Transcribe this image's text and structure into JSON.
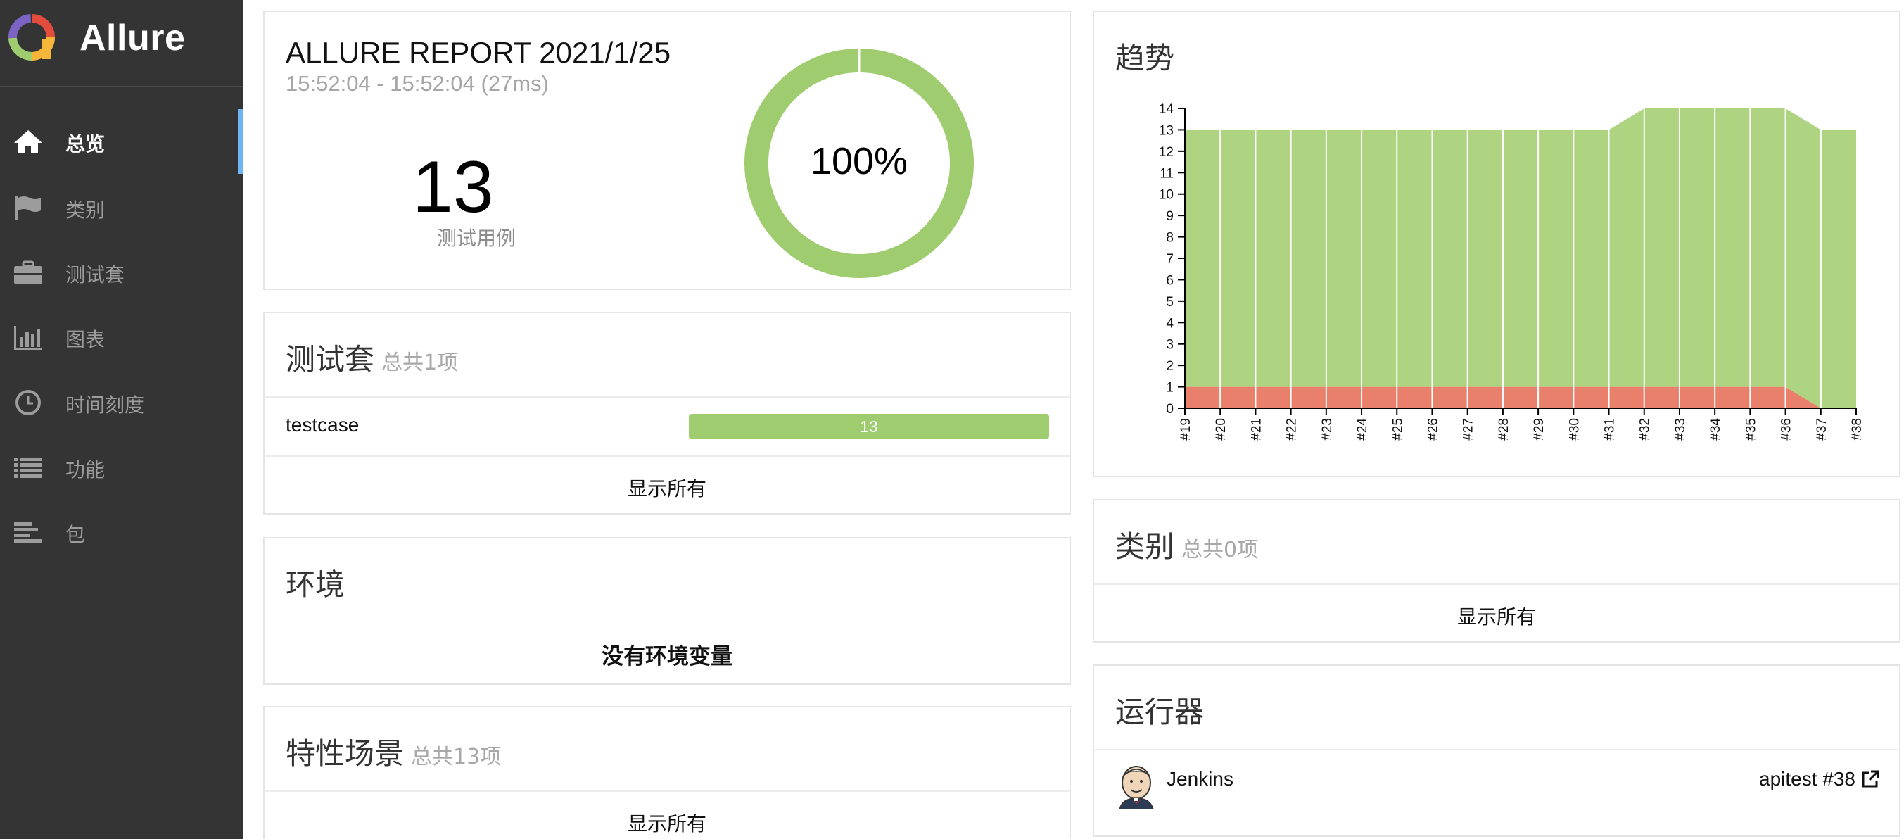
{
  "app": {
    "name": "Allure"
  },
  "sidebar": {
    "items": [
      {
        "label": "总览",
        "icon": "home-icon",
        "active": true
      },
      {
        "label": "类别",
        "icon": "flag-icon",
        "active": false
      },
      {
        "label": "测试套",
        "icon": "briefcase-icon",
        "active": false
      },
      {
        "label": "图表",
        "icon": "bar-chart-icon",
        "active": false
      },
      {
        "label": "时间刻度",
        "icon": "clock-icon",
        "active": false
      },
      {
        "label": "功能",
        "icon": "list-icon",
        "active": false
      },
      {
        "label": "包",
        "icon": "align-left-icon",
        "active": false
      }
    ],
    "active_color": "#6eb4f0"
  },
  "summary": {
    "title": "ALLURE REPORT 2021/1/25",
    "time": "15:52:04 - 15:52:04 (27ms)",
    "count": "13",
    "count_label": "测试用例",
    "percent": "100%",
    "pass_ratio": 1.0,
    "pass_color": "#9fcc6e"
  },
  "suites": {
    "title": "测试套",
    "subtitle": "总共1项",
    "rows": [
      {
        "name": "testcase",
        "count": "13"
      }
    ],
    "show_all": "显示所有"
  },
  "environment": {
    "title": "环境",
    "empty": "没有环境变量"
  },
  "features": {
    "title": "特性场景",
    "subtitle": "总共13项",
    "show_all": "显示所有"
  },
  "trend": {
    "title": "趋势"
  },
  "categories": {
    "title": "类别",
    "subtitle": "总共0项",
    "show_all": "显示所有"
  },
  "executors": {
    "title": "运行器",
    "name": "Jenkins",
    "build": "apitest #38",
    "avatar_icon": "jenkins-avatar-icon",
    "link_icon": "external-link-icon"
  },
  "chart_data": {
    "type": "area",
    "x": [
      "#19",
      "#20",
      "#21",
      "#22",
      "#23",
      "#24",
      "#25",
      "#26",
      "#27",
      "#28",
      "#29",
      "#30",
      "#31",
      "#32",
      "#33",
      "#34",
      "#35",
      "#36",
      "#37",
      "#38"
    ],
    "series": [
      {
        "values": [
          1,
          1,
          1,
          1,
          1,
          1,
          1,
          1,
          1,
          1,
          1,
          1,
          1,
          1,
          1,
          1,
          1,
          1,
          0,
          0
        ],
        "color": "#e8806c"
      },
      {
        "values": [
          12,
          12,
          12,
          12,
          12,
          12,
          12,
          12,
          12,
          12,
          12,
          12,
          12,
          13,
          13,
          13,
          13,
          13,
          13,
          13
        ],
        "color": "#aed381"
      }
    ],
    "stacked": true,
    "yticks": [
      0,
      1,
      2,
      3,
      4,
      5,
      6,
      7,
      8,
      9,
      10,
      11,
      12,
      13,
      14
    ],
    "ylim": [
      0,
      14
    ],
    "grid": false,
    "vertical_separators": true
  }
}
